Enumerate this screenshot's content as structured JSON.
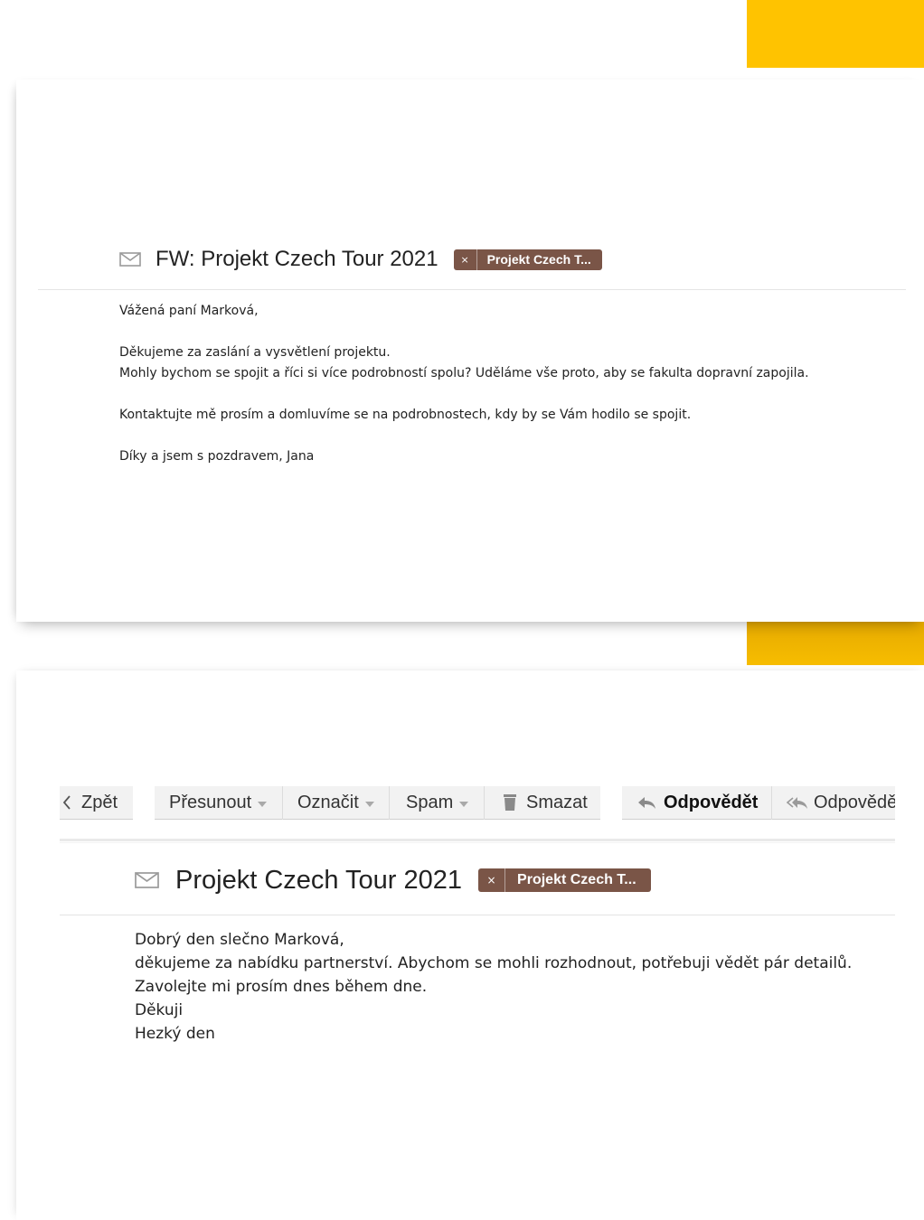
{
  "email1": {
    "subject": "FW: Projekt Czech Tour 2021",
    "tag": {
      "remove_symbol": "×",
      "label": "Projekt Czech T..."
    },
    "body": {
      "line1": "Vážená paní Marková,",
      "line2": "Děkujeme za zaslání a vysvětlení projektu.",
      "line3": "Mohly bychom se spojit a říci si více podrobností spolu? Uděláme vše proto, aby se fakulta dopravní zapojila.",
      "line4": "Kontaktujte mě prosím a domluvíme se na podrobnostech, kdy by se Vám hodilo se spojit.",
      "line5": "Díky a jsem s pozdravem, Jana"
    }
  },
  "email2": {
    "toolbar": {
      "back": "Zpět",
      "move": "Přesunout",
      "mark": "Označit",
      "spam": "Spam",
      "delete": "Smazat",
      "reply": "Odpovědět",
      "reply_all": "Odpovědě"
    },
    "subject": "Projekt Czech Tour 2021",
    "tag": {
      "remove_symbol": "×",
      "label": "Projekt Czech T..."
    },
    "body": {
      "line1": "Dobrý den slečno Marková,",
      "line2": "děkujeme za nabídku partnerství. Abychom se mohli rozhodnout, potřebuji vědět pár detailů.",
      "line3": "Zavolejte mi prosím dnes během dne.",
      "line4": "Děkuji",
      "line5": "Hezký den"
    }
  },
  "colors": {
    "accent": "#ffc300",
    "tag_background": "#7a5547",
    "toolbar_background": "#f2f2f2"
  },
  "icons": [
    "envelope-icon",
    "chevron-left-icon",
    "caret-down-icon",
    "trash-icon",
    "reply-icon",
    "reply-all-icon"
  ]
}
